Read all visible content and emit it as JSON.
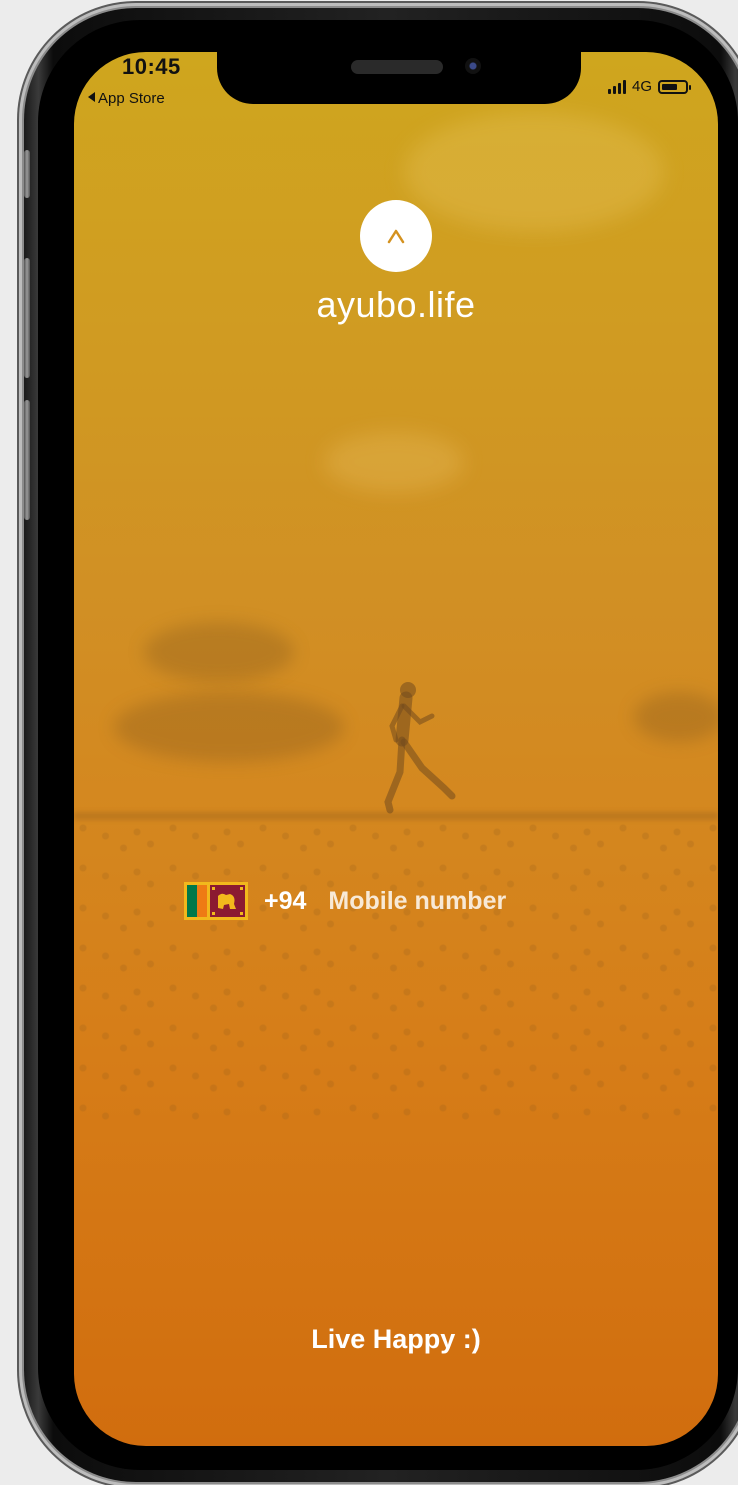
{
  "status_bar": {
    "time": "10:45",
    "back_label": "App Store",
    "network": "4G",
    "battery_level": 0.7
  },
  "brand": {
    "logo_mark": "^",
    "logo_text": "ayubo.life"
  },
  "login": {
    "country_flag": "sri-lanka-flag-icon",
    "country_code": "+94",
    "mobile_placeholder": "Mobile number",
    "mobile_value": ""
  },
  "footer": {
    "tagline": "Live Happy :)"
  },
  "colors": {
    "gradient_top": "#cfa61e",
    "gradient_bottom": "#d16d0e",
    "text": "#ffffff"
  }
}
